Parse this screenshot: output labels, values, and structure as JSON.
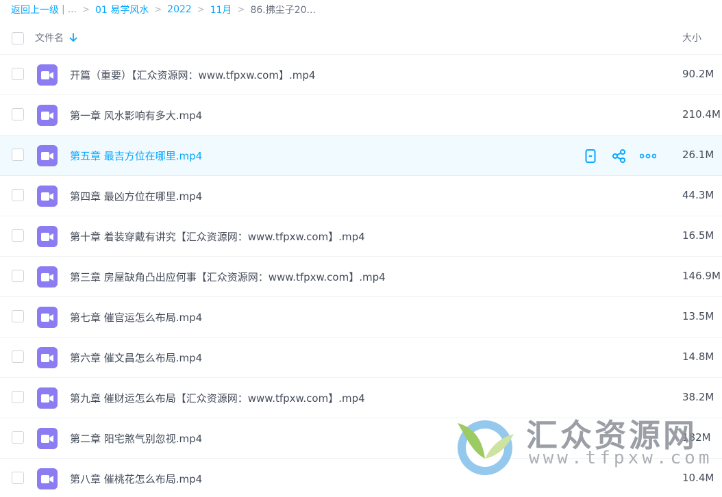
{
  "breadcrumb": {
    "back_label": "返回上一级",
    "divider": "|",
    "ellipsis": "...",
    "items": [
      "01 易学风水",
      "2022",
      "11月"
    ],
    "current": "86.拂尘子20..."
  },
  "header": {
    "name_label": "文件名",
    "size_label": "大小"
  },
  "files": [
    {
      "name": "开篇（重要）【汇众资源网：www.tfpxw.com】.mp4",
      "size": "90.2M",
      "hover": false
    },
    {
      "name": "第一章 风水影响有多大.mp4",
      "size": "210.4M",
      "hover": false
    },
    {
      "name": "第五章 最吉方位在哪里.mp4",
      "size": "26.1M",
      "hover": true
    },
    {
      "name": "第四章 最凶方位在哪里.mp4",
      "size": "44.3M",
      "hover": false
    },
    {
      "name": "第十章 着装穿戴有讲究【汇众资源网：www.tfpxw.com】.mp4",
      "size": "16.5M",
      "hover": false
    },
    {
      "name": "第三章 房屋缺角凸出应何事【汇众资源网：www.tfpxw.com】.mp4",
      "size": "146.9M",
      "hover": false
    },
    {
      "name": "第七章 催官运怎么布局.mp4",
      "size": "13.5M",
      "hover": false
    },
    {
      "name": "第六章 催文昌怎么布局.mp4",
      "size": "14.8M",
      "hover": false
    },
    {
      "name": "第九章 催财运怎么布局【汇众资源网：www.tfpxw.com】.mp4",
      "size": "38.2M",
      "hover": false
    },
    {
      "name": "第二章 阳宅煞气别忽视.mp4",
      "size": "182M",
      "hover": false
    },
    {
      "name": "第八章 催桃花怎么布局.mp4",
      "size": "10.4M",
      "hover": false
    }
  ],
  "row_actions": [
    "phone-icon",
    "share-icon",
    "more-icon"
  ],
  "watermark": {
    "title": "汇众资源网",
    "url": "www.tfpxw.com"
  },
  "colors": {
    "accent": "#06a7ff",
    "video_icon": "#8c7cf2",
    "hover_row": "#f0faff"
  }
}
